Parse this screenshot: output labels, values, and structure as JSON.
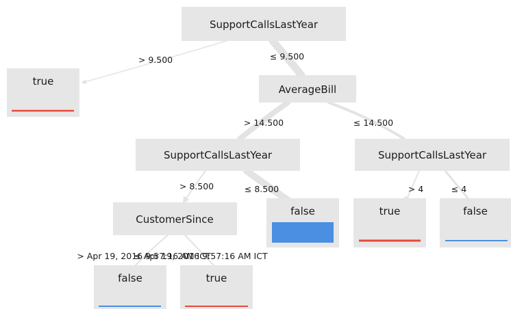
{
  "tree": {
    "nodes": {
      "root": {
        "label": "SupportCallsLastYear",
        "kind": "split"
      },
      "n_true_top": {
        "label": "true",
        "kind": "leaf",
        "bar": "line",
        "bar_color": "#e8483b"
      },
      "avg_bill": {
        "label": "AverageBill",
        "kind": "split"
      },
      "calls_left": {
        "label": "SupportCallsLastYear",
        "kind": "split"
      },
      "calls_right": {
        "label": "SupportCallsLastYear",
        "kind": "split"
      },
      "customer_since": {
        "label": "CustomerSince",
        "kind": "split"
      },
      "n_false_mid": {
        "label": "false",
        "kind": "leaf",
        "bar": "fill",
        "bar_color": "#4a8fe2"
      },
      "n_true_r": {
        "label": "true",
        "kind": "leaf",
        "bar": "line",
        "bar_color": "#e8483b"
      },
      "n_false_r": {
        "label": "false",
        "kind": "leaf",
        "bar": "line",
        "bar_color": "#4a8fe2"
      },
      "n_false_bot": {
        "label": "false",
        "kind": "leaf",
        "bar": "line",
        "bar_color": "#4a8fe2"
      },
      "n_true_bot": {
        "label": "true",
        "kind": "leaf",
        "bar": "line",
        "bar_color": "#e8483b"
      }
    },
    "edges": {
      "root_gt": {
        "label": "> 9.500"
      },
      "root_le": {
        "label": "≤ 9.500"
      },
      "bill_gt": {
        "label": "> 14.500"
      },
      "bill_le": {
        "label": "≤ 14.500"
      },
      "callsL_gt": {
        "label": "> 8.500"
      },
      "callsL_le": {
        "label": "≤ 8.500"
      },
      "callsR_gt": {
        "label": "> 4"
      },
      "callsR_le": {
        "label": "≤ 4"
      },
      "cust_gt": {
        "label": "> Apr 19, 2016 9:57:16 AM ICT"
      },
      "cust_le": {
        "label": "≤ Apr 19, 2016 9:57:16 AM ICT"
      }
    },
    "colors": {
      "node_fill": "#e6e6e6",
      "edge": "#e3e3e3",
      "true_color": "#e8483b",
      "false_color": "#4a8fe2"
    }
  }
}
